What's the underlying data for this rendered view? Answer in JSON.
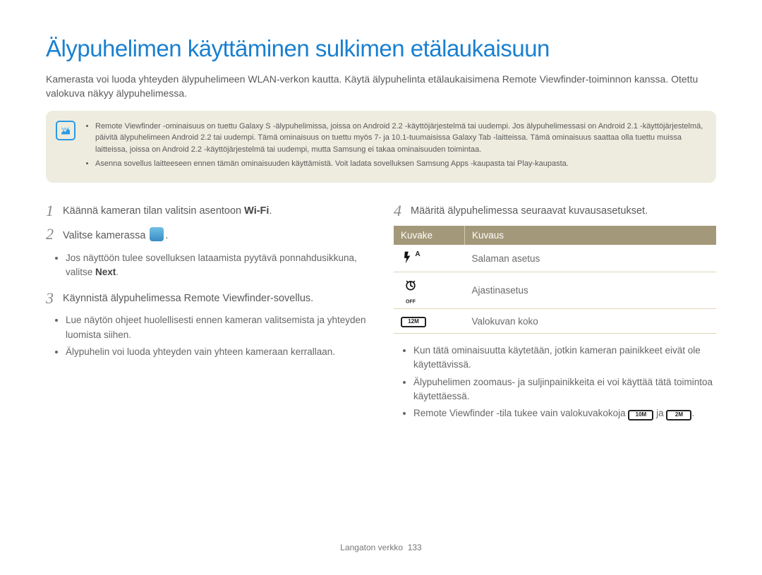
{
  "title": "Älypuhelimen käyttäminen sulkimen etälaukaisuun",
  "intro": "Kamerasta voi luoda yhteyden älypuhelimeen WLAN-verkon kautta. Käytä älypuhelinta etälaukaisimena Remote Viewfinder-toiminnon kanssa. Otettu valokuva näkyy älypuhelimessa.",
  "notes": {
    "li1": "Remote Viewfinder -ominaisuus on tuettu Galaxy S -älypuhelimissa, joissa on Android 2.2 -käyttöjärjestelmä tai uudempi. Jos älypuhelimessasi on Android 2.1 -käyttöjärjestelmä, päivitä älypuhelimeen Android 2.2 tai uudempi. Tämä ominaisuus on tuettu myös 7- ja 10.1-tuumaisissa Galaxy Tab -laitteissa. Tämä ominaisuus saattaa olla tuettu muissa laitteissa, joissa on Android 2.2 -käyttöjärjestelmä tai uudempi, mutta Samsung ei takaa ominaisuuden toimintaa.",
    "li2": "Asenna sovellus laitteeseen ennen tämän ominaisuuden käyttämistä. Voit ladata sovelluksen Samsung Apps -kaupasta tai Play-kaupasta."
  },
  "left": {
    "step1_pre": "Käännä kameran tilan valitsin asentoon ",
    "step1_wifi": "Wi-Fi",
    "step1_post": ".",
    "step2_pre": "Valitse kamerassa ",
    "step2_post": ".",
    "step2_b1_pre": "Jos näyttöön tulee sovelluksen lataamista pyytävä ponnahdusikkuna, valitse ",
    "step2_b1_bold": "Next",
    "step2_b1_post": ".",
    "step3": "Käynnistä älypuhelimessa Remote Viewfinder-sovellus.",
    "step3_b1": "Lue näytön ohjeet huolellisesti ennen kameran valitsemista ja yhteyden luomista siihen.",
    "step3_b2": "Älypuhelin voi luoda yhteyden vain yhteen kameraan kerrallaan."
  },
  "right": {
    "step4": "Määritä älypuhelimessa seuraavat kuvausasetukset.",
    "table": {
      "h1": "Kuvake",
      "h2": "Kuvaus",
      "r1_desc": "Salaman asetus",
      "r2_desc": "Ajastinasetus",
      "r3_desc": "Valokuvan koko",
      "r1_icon_label": "A",
      "r2_icon_label": "OFF",
      "r3_icon_label": "12M"
    },
    "b1": "Kun tätä ominaisuutta käytetään, jotkin kameran painikkeet eivät ole käytettävissä.",
    "b2": "Älypuhelimen zoomaus- ja suljinpainikkeita ei voi käyttää tätä toimintoa käytettäessä.",
    "b3_pre": "Remote Viewfinder -tila tukee vain valokuvakokoja ",
    "b3_badge1": "10M",
    "b3_mid": " ja ",
    "b3_badge2": "2M",
    "b3_post": "."
  },
  "footer": {
    "section": "Langaton verkko",
    "page": "133"
  }
}
